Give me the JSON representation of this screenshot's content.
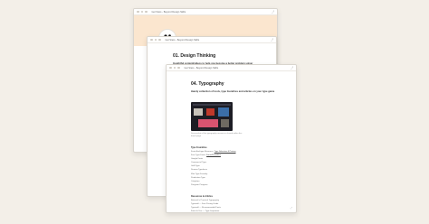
{
  "windows": {
    "profile": {
      "tab_title": "Get Stars - Beyond Design Skills",
      "banner_color": "#fbe6cf",
      "avatar_icon": "avatar-logo-icon"
    },
    "design_thinking": {
      "tab_title": "Get Stars - Beyond Design Skills",
      "title": "01. Design Thinking",
      "subtitle": "Insightful content/videos to help you become a better problem solver"
    },
    "typography": {
      "tab_title": "Get Stars - Beyond Design Skills",
      "title": "04. Typography",
      "subtitle": "Handy collection of tools, type foundries and articles on your type game",
      "caption": "Screenshot of the typography resources shared within this board page",
      "section_foundries": "Type Foundries",
      "foundries": [
        {
          "prefix": "Front-End type Resource: ",
          "link": "Type Selection & Pairing"
        },
        {
          "prefix": "Free Type Fonts: ",
          "link": "Fonts/Foundries"
        },
        {
          "prefix": "Google Fonts",
          "link": ""
        },
        {
          "prefix": "Commercial Type",
          "link": ""
        },
        {
          "prefix": "Grilli Type",
          "link": ""
        },
        {
          "prefix": "Dinamo Typefaces",
          "link": ""
        },
        {
          "prefix": "Klim Type Foundry",
          "link": ""
        },
        {
          "prefix": "Production Type",
          "link": ""
        },
        {
          "prefix": "Colophon",
          "link": ""
        },
        {
          "prefix": "Pangram Pangram",
          "link": ""
        }
      ],
      "section_resources": "Resources & Articles",
      "resources": [
        {
          "prefix": "Butterick's Practical Typography",
          "link": ""
        },
        {
          "prefix": "Typewolf — Font Pairing Guide",
          "link": ""
        },
        {
          "prefix": "Typewolf — Recommended Fonts",
          "link": ""
        },
        {
          "prefix": "Fonts In Use — Type Inspiration",
          "link": ""
        },
        {
          "prefix": "Fontshare",
          "link": ""
        }
      ]
    }
  },
  "colors": {
    "background": "#f3efe8",
    "window": "#ffffff",
    "heading": "#222222"
  }
}
